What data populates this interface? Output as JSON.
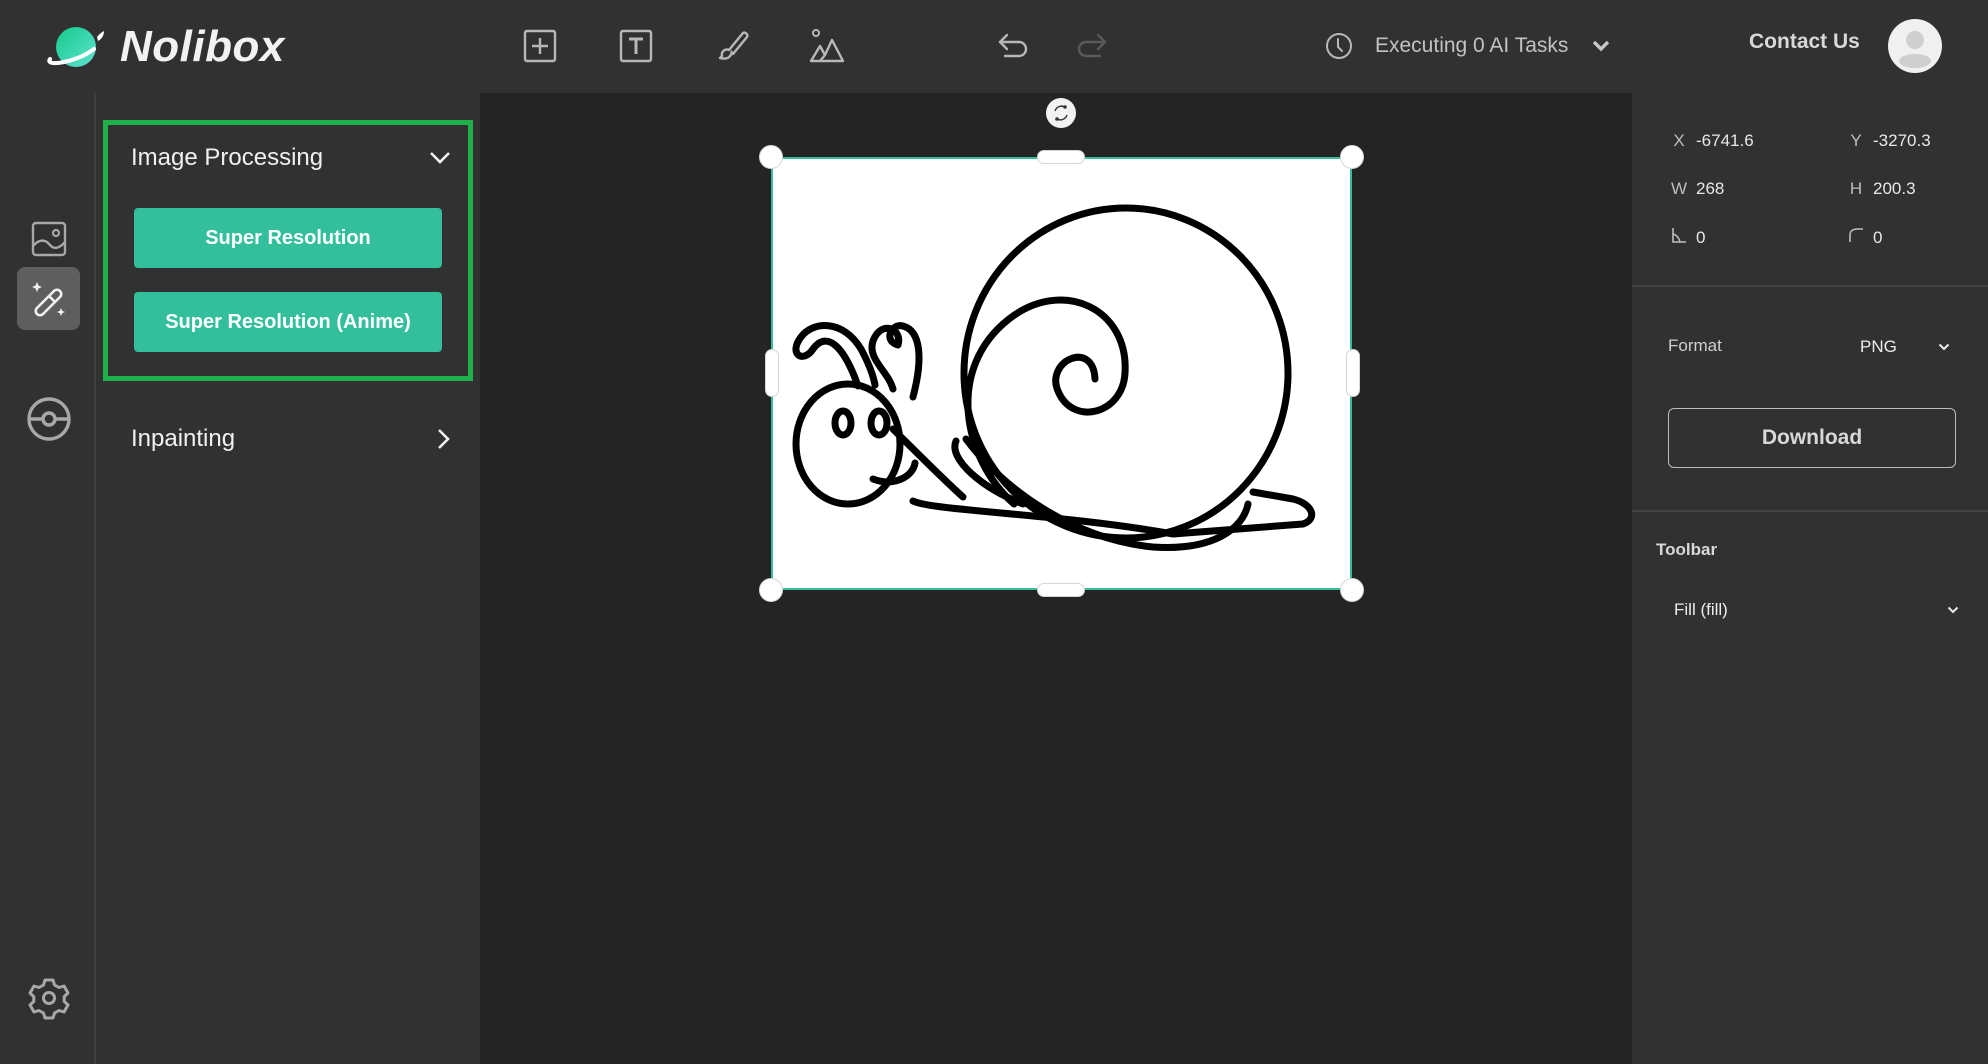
{
  "app": {
    "name": "Nolibox",
    "brand_color": "#33bf9c"
  },
  "header": {
    "tools": [
      {
        "name": "add-frame",
        "icon": "plus-square-icon"
      },
      {
        "name": "add-text",
        "icon": "text-square-icon"
      },
      {
        "name": "brush",
        "icon": "brush-icon"
      },
      {
        "name": "add-image",
        "icon": "mountain-image-icon"
      }
    ],
    "undo_icon": "undo-icon",
    "redo_icon": "redo-icon",
    "tasks_label": "Executing 0 AI Tasks",
    "contact_label": "Contact Us"
  },
  "rail": {
    "items": [
      {
        "name": "images",
        "icon": "image-icon",
        "active": false
      },
      {
        "name": "ai-tools",
        "icon": "magic-wand-icon",
        "active": true
      },
      {
        "name": "plugins",
        "icon": "pokeball-icon",
        "active": false
      }
    ],
    "settings_icon": "gear-icon"
  },
  "panel": {
    "sections": [
      {
        "title": "Image Processing",
        "expanded": true,
        "buttons": [
          "Super Resolution",
          "Super Resolution (Anime)"
        ]
      },
      {
        "title": "Inpainting",
        "expanded": false,
        "buttons": []
      }
    ]
  },
  "properties": {
    "x_label": "X",
    "x_value": "-6741.6",
    "y_label": "Y",
    "y_value": "-3270.3",
    "w_label": "W",
    "w_value": "268",
    "h_label": "H",
    "h_value": "200.3",
    "rotation_value": "0",
    "radius_value": "0",
    "format_label": "Format",
    "format_value": "PNG",
    "download_label": "Download",
    "toolbar_title": "Toolbar",
    "toolbar_value": "Fill (fill)"
  }
}
